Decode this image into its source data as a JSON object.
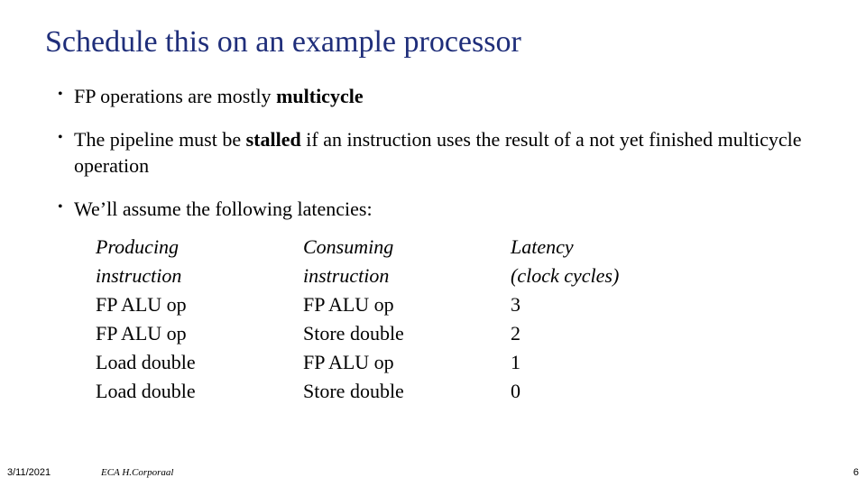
{
  "title": "Schedule this on an example processor",
  "bullets": {
    "b1_pre": "FP operations are mostly ",
    "b1_bold": "multicycle",
    "b2_pre": "The pipeline must be ",
    "b2_bold": "stalled",
    "b2_post": " if an instruction uses the result of a not yet finished multicycle operation",
    "b3": "We’ll assume the following latencies:"
  },
  "table": {
    "h1a": "Producing",
    "h1b": "instruction",
    "h2a": "Consuming",
    "h2b": "instruction",
    "h3a": "Latency",
    "h3b": "(clock cycles)",
    "rows": [
      {
        "p": "FP ALU op",
        "c": "FP ALU op",
        "l": "3"
      },
      {
        "p": "FP ALU op",
        "c": "Store double",
        "l": "2"
      },
      {
        "p": "Load double",
        "c": "FP ALU op",
        "l": "1"
      },
      {
        "p": "Load double",
        "c": "Store double",
        "l": "0"
      }
    ]
  },
  "footer": {
    "date": "3/11/2021",
    "center": "ECA  H.Corporaal",
    "page": "6"
  }
}
